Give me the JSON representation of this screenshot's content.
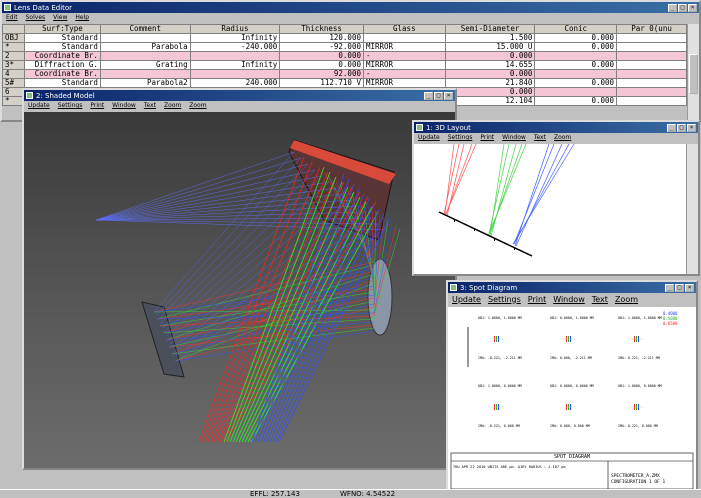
{
  "lde": {
    "title": "Lens Data Editor",
    "menu": [
      "Edit",
      "Solves",
      "View",
      "Help"
    ],
    "columns": [
      "Surf:Type",
      "Comment",
      "Radius",
      "Thickness",
      "Glass",
      "Semi-Diameter",
      "Conic",
      "Par 0(unu"
    ],
    "rows": [
      {
        "surf": "OBJ",
        "type": "Standard",
        "comment": "",
        "radius": "Infinity",
        "thickness": "120.000",
        "glass": "",
        "semi": "1.500",
        "conic": "0.000",
        "par": "",
        "pink": false
      },
      {
        "surf": "*",
        "type": "Standard",
        "comment": "Parabola",
        "radius": "-240.000",
        "thickness": "-92.000",
        "glass": "MIRROR",
        "semi": "15.000 U",
        "conic": "0.000",
        "par": "",
        "pink": false
      },
      {
        "surf": "2",
        "type": "Coordinate Br.",
        "comment": "",
        "radius": "",
        "thickness": "0.000",
        "glass": "-",
        "semi": "0.000",
        "conic": "",
        "par": "",
        "pink": true
      },
      {
        "surf": "3*",
        "type": "Diffraction G.",
        "comment": "Grating",
        "radius": "Infinity",
        "thickness": "0.000",
        "glass": "MIRROR",
        "semi": "14.655",
        "conic": "0.000",
        "par": "",
        "pink": false
      },
      {
        "surf": "4",
        "type": "Coordinate Br.",
        "comment": "",
        "radius": "",
        "thickness": "92.000",
        "glass": "-",
        "semi": "0.000",
        "conic": "",
        "par": "",
        "pink": true
      },
      {
        "surf": "5#",
        "type": "Standard",
        "comment": "Parabola2",
        "radius": "240.000",
        "thickness": "112.710 V",
        "glass": "MIRROR",
        "semi": "21.840",
        "conic": "0.000",
        "par": "",
        "pink": false
      },
      {
        "surf": "6",
        "type": "Coordinate Br.",
        "comment": "",
        "radius": "",
        "thickness": "",
        "glass": "-",
        "semi": "0.000",
        "conic": "",
        "par": "",
        "pink": true
      },
      {
        "surf": "*",
        "type": "",
        "comment": "",
        "radius": "",
        "thickness": "",
        "glass": "",
        "semi": "12.104",
        "conic": "0.000",
        "par": "",
        "pink": false
      }
    ]
  },
  "shaded": {
    "title": "2: Shaded Model",
    "menu": [
      "Update",
      "Settings",
      "Print",
      "Window",
      "Text",
      "Zoom",
      "Zoom"
    ]
  },
  "layout": {
    "title": "1: 3D Layout",
    "menu": [
      "Update",
      "Settings",
      "Print",
      "Window",
      "Text",
      "Zoom"
    ]
  },
  "spot": {
    "title": "3: Spot Diagram",
    "menu": [
      "Update",
      "Settings",
      "Print",
      "Window",
      "Text",
      "Zoom"
    ],
    "footer_title": "SPOT DIAGRAM",
    "footer_left": "THU APR 22 2010  UNITS ARE µm.  AIRY RADIUS : 2.107 µm",
    "footer_file": "SPECTROMETER_A.ZMX",
    "footer_config": "CONFIGURATION 1 OF 1",
    "legend": [
      "0.4000",
      "0.5000",
      "0.6500"
    ],
    "fields": [
      {
        "obj": "OBJ: 1.0000, 1.0000 MM",
        "ima": "IMA: -8.221, -2.211 MM"
      },
      {
        "obj": "OBJ: 0.0000, 1.0000 MM",
        "ima": "IMA: 0.000, -2.211 MM"
      },
      {
        "obj": "OBJ: 1.0000, 1.0000 MM",
        "ima": "IMA: 8.221, -2.211 MM"
      },
      {
        "obj": "OBJ: 1.0000, 0.0000 MM",
        "ima": "IMA: -8.221, 0.000 MM"
      },
      {
        "obj": "OBJ: 0.0000, 0.0000 MM",
        "ima": "IMA: 0.000, 0.000 MM"
      },
      {
        "obj": "OBJ: 1.0000, 0.0000 MM",
        "ima": "IMA: 8.221, 0.000 MM"
      }
    ]
  },
  "status": {
    "efl": "EFFL: 257.143",
    "wfno": "WFNO: 4.54522"
  },
  "colors": {
    "red": "#ff2020",
    "green": "#20e020",
    "blue": "#2040ff",
    "pink": "#f4c6d6"
  }
}
